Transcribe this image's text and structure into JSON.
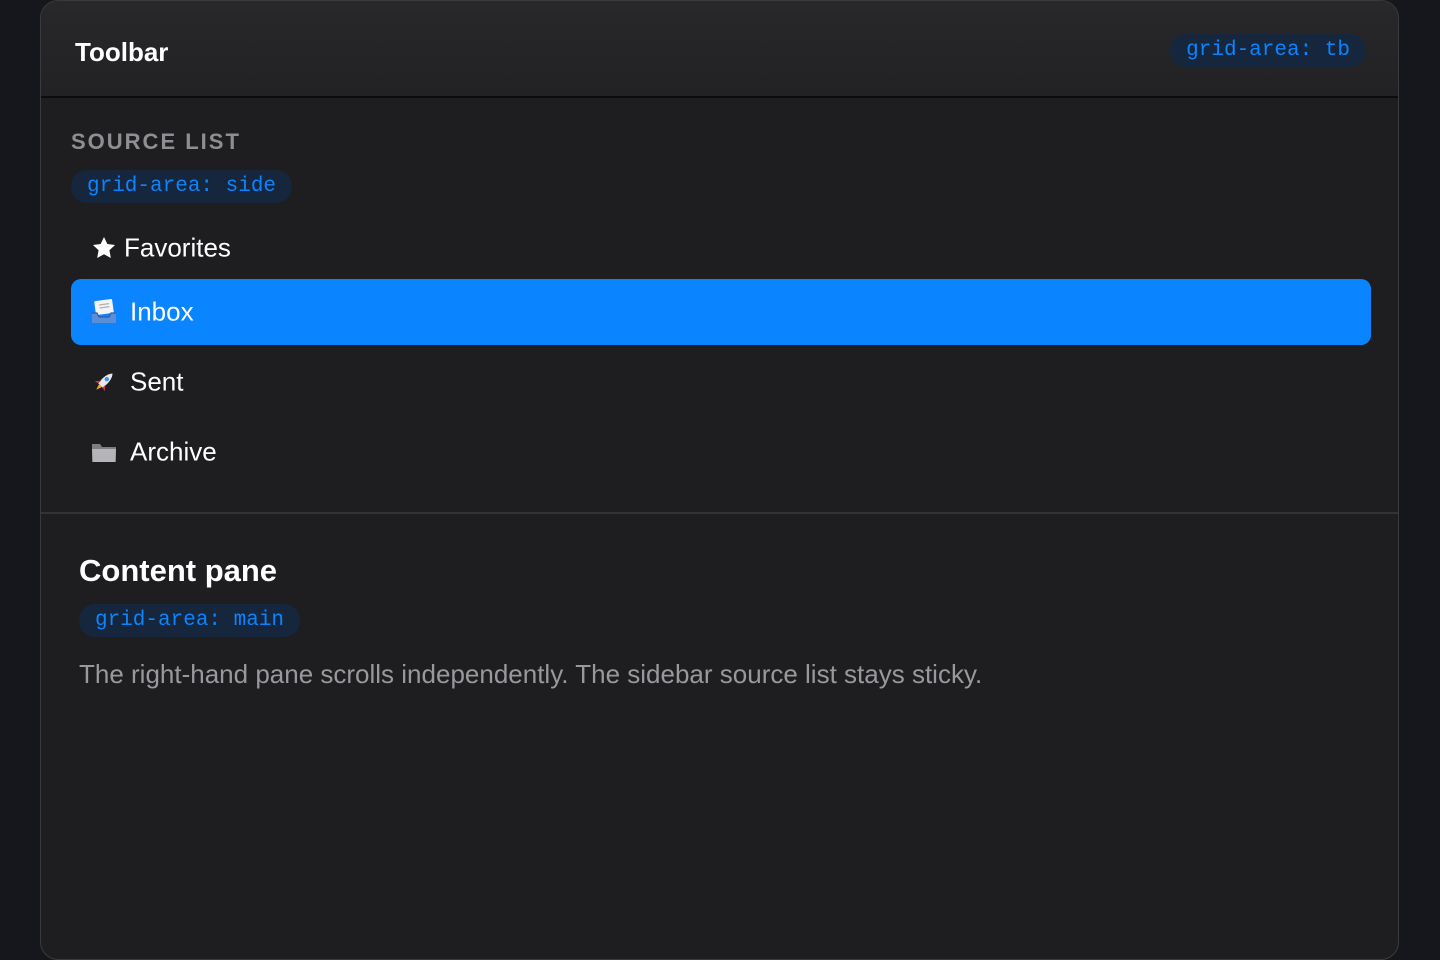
{
  "toolbar": {
    "title": "Toolbar",
    "area_label": "grid-area: tb"
  },
  "sidebar": {
    "heading": "SOURCE LIST",
    "area_label": "grid-area: side",
    "items": [
      {
        "label": "Favorites",
        "icon": "star-icon",
        "selected": false
      },
      {
        "label": "Inbox",
        "icon": "inbox-tray-icon",
        "selected": true
      },
      {
        "label": "Sent",
        "icon": "rocket-icon",
        "selected": false
      },
      {
        "label": "Archive",
        "icon": "folder-icon",
        "selected": false
      }
    ]
  },
  "content": {
    "title": "Content pane",
    "area_label": "grid-area: main",
    "description": "The right-hand pane scrolls independently. The sidebar source list stays sticky."
  },
  "colors": {
    "accent": "#0a84ff",
    "window_bg": "#1e1e20",
    "page_bg": "#16161d",
    "chip_bg": "#16263d",
    "secondary_text": "#98989d"
  }
}
